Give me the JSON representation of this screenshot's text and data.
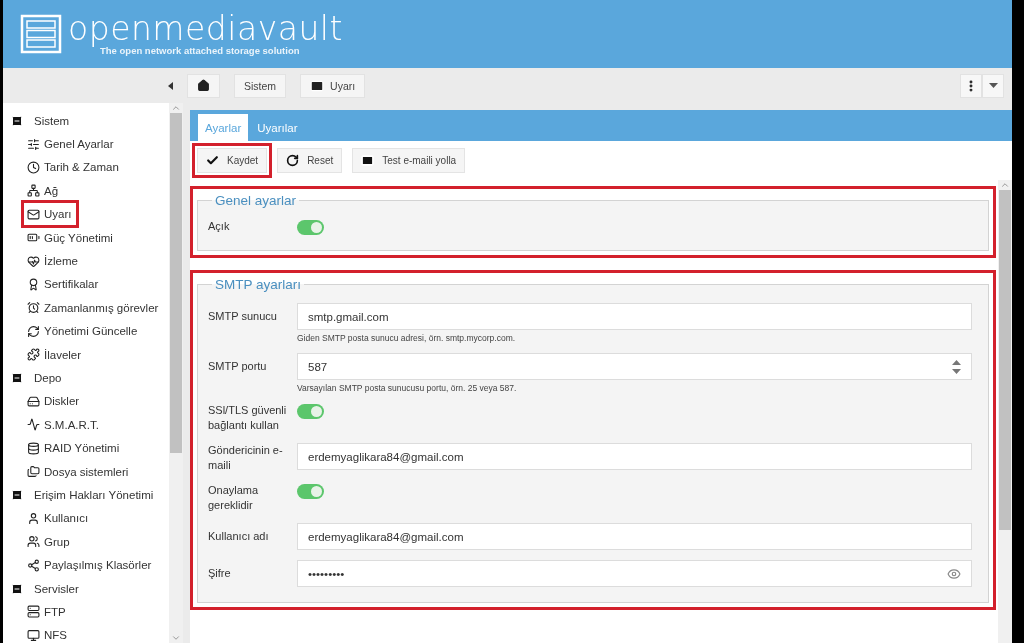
{
  "header": {
    "logo_text": "openmediavault",
    "tagline": "The open network attached storage solution"
  },
  "breadcrumb": {
    "items": [
      {
        "kind": "home"
      },
      {
        "kind": "text",
        "label": "Sistem"
      },
      {
        "kind": "mail",
        "label": "Uyarı"
      }
    ]
  },
  "sidebar": {
    "groups": [
      {
        "label": "Sistem",
        "expanded": true,
        "children": [
          {
            "label": "Genel Ayarlar",
            "highlighted": false
          },
          {
            "label": "Tarih & Zaman",
            "highlighted": false
          },
          {
            "label": "Ağ",
            "highlighted": false
          },
          {
            "label": "Uyarı",
            "highlighted": true
          },
          {
            "label": "Güç Yönetimi",
            "highlighted": false
          },
          {
            "label": "İzleme",
            "highlighted": false
          },
          {
            "label": "Sertifikalar",
            "highlighted": false
          },
          {
            "label": "Zamanlanmış görevler",
            "highlighted": false
          },
          {
            "label": "Yönetimi Güncelle",
            "highlighted": false
          },
          {
            "label": "İlaveler",
            "highlighted": false
          }
        ]
      },
      {
        "label": "Depo",
        "expanded": true,
        "children": [
          {
            "label": "Diskler",
            "highlighted": false
          },
          {
            "label": "S.M.A.R.T.",
            "highlighted": false
          },
          {
            "label": "RAID Yönetimi",
            "highlighted": false
          },
          {
            "label": "Dosya sistemleri",
            "highlighted": false
          }
        ]
      },
      {
        "label": "Erişim Hakları Yönetimi",
        "expanded": true,
        "children": [
          {
            "label": "Kullanıcı",
            "highlighted": false
          },
          {
            "label": "Grup",
            "highlighted": false
          },
          {
            "label": "Paylaşılmış Klasörler",
            "highlighted": false
          }
        ]
      },
      {
        "label": "Servisler",
        "expanded": true,
        "children": [
          {
            "label": "FTP",
            "highlighted": false
          },
          {
            "label": "NFS",
            "highlighted": false
          }
        ]
      }
    ]
  },
  "tabs": [
    {
      "label": "Ayarlar",
      "selected": true
    },
    {
      "label": "Uyarılar",
      "selected": false
    }
  ],
  "toolbar": [
    {
      "kind": "check",
      "label": "Kaydet",
      "highlighted": true
    },
    {
      "kind": "reset",
      "label": "Reset",
      "highlighted": false
    },
    {
      "kind": "mail",
      "label": "Test e-maili yolla",
      "highlighted": false
    }
  ],
  "sections": [
    {
      "title": "Genel ayarlar",
      "highlighted": true,
      "fields": [
        {
          "kind": "toggle",
          "label": "Açık",
          "on": true
        }
      ]
    },
    {
      "title": "SMTP ayarları",
      "highlighted": true,
      "fields": [
        {
          "kind": "text",
          "label": "SMTP sunucu",
          "value": "smtp.gmail.com",
          "hint": "Giden SMTP posta sunucu adresi, örn. smtp.mycorp.com."
        },
        {
          "kind": "number",
          "label": "SMTP portu",
          "value": "587",
          "hint": "Varsayılan SMTP posta sunucusu portu, örn. 25 veya 587."
        },
        {
          "kind": "toggle",
          "label": "SSl/TLS güvenli bağlantı kullan",
          "on": true
        },
        {
          "kind": "text",
          "label": "Göndericinin e-maili",
          "value": "erdemyaglikara84@gmail.com"
        },
        {
          "kind": "toggle",
          "label": "Onaylama gereklidir",
          "on": true
        },
        {
          "kind": "text",
          "label": "Kullanıcı adı",
          "value": "erdemyaglikara84@gmail.com"
        },
        {
          "kind": "password",
          "label": "Şifre",
          "value": "•••••••••"
        }
      ]
    }
  ]
}
